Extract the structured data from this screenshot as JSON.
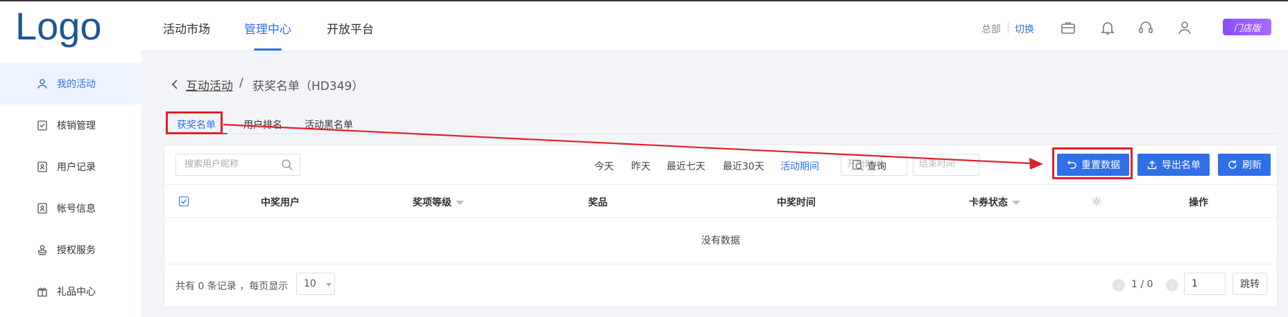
{
  "header": {
    "logo": "Logo",
    "nav": [
      {
        "label": "活动市场"
      },
      {
        "label": "管理中心"
      },
      {
        "label": "开放平台"
      }
    ],
    "hq_label": "总部",
    "switch_label": "切换",
    "store_badge": "门店版",
    "icons": [
      "briefcase-icon",
      "bell-icon",
      "headset-icon",
      "user-icon"
    ]
  },
  "sidebar": {
    "items": [
      {
        "label": "我的活动",
        "icon": "user-icon"
      },
      {
        "label": "核销管理",
        "icon": "check-clipboard-icon"
      },
      {
        "label": "用户记录",
        "icon": "id-card-icon"
      },
      {
        "label": "帐号信息",
        "icon": "id-card-icon"
      },
      {
        "label": "授权服务",
        "icon": "stamp-icon"
      },
      {
        "label": "礼品中心",
        "icon": "gift-icon"
      }
    ]
  },
  "breadcrumb": {
    "back_icon": "chevron-left-icon",
    "parent": "互动活动",
    "separator": "/",
    "current": "获奖名单（HD349）"
  },
  "tabs": [
    {
      "label": "获奖名单"
    },
    {
      "label": "用户排名"
    },
    {
      "label": "活动黑名单"
    }
  ],
  "filter": {
    "search_placeholder": "搜索用户昵称",
    "quick": [
      "今天",
      "昨天",
      "最近七天",
      "最近30天",
      "活动期间"
    ],
    "start_placeholder": "开始时间",
    "end_placeholder": "结束时间",
    "query_label": "查询",
    "buttons": {
      "reset": "重置数据",
      "export": "导出名单",
      "refresh": "刷新"
    }
  },
  "table": {
    "columns": [
      "中奖用户",
      "奖项等级",
      "奖品",
      "中奖时间",
      "卡券状态",
      "操作"
    ],
    "empty_text": "没有数据"
  },
  "pagination": {
    "total_text": "共有 0 条记录 ，每页显示",
    "page_size": "10",
    "page_indicator": "1 / 0",
    "page_input": "1",
    "jump_label": "跳转"
  },
  "colors": {
    "accent": "#2f6fe8",
    "annotation": "#e0202a",
    "badge": "#9a5cff"
  }
}
